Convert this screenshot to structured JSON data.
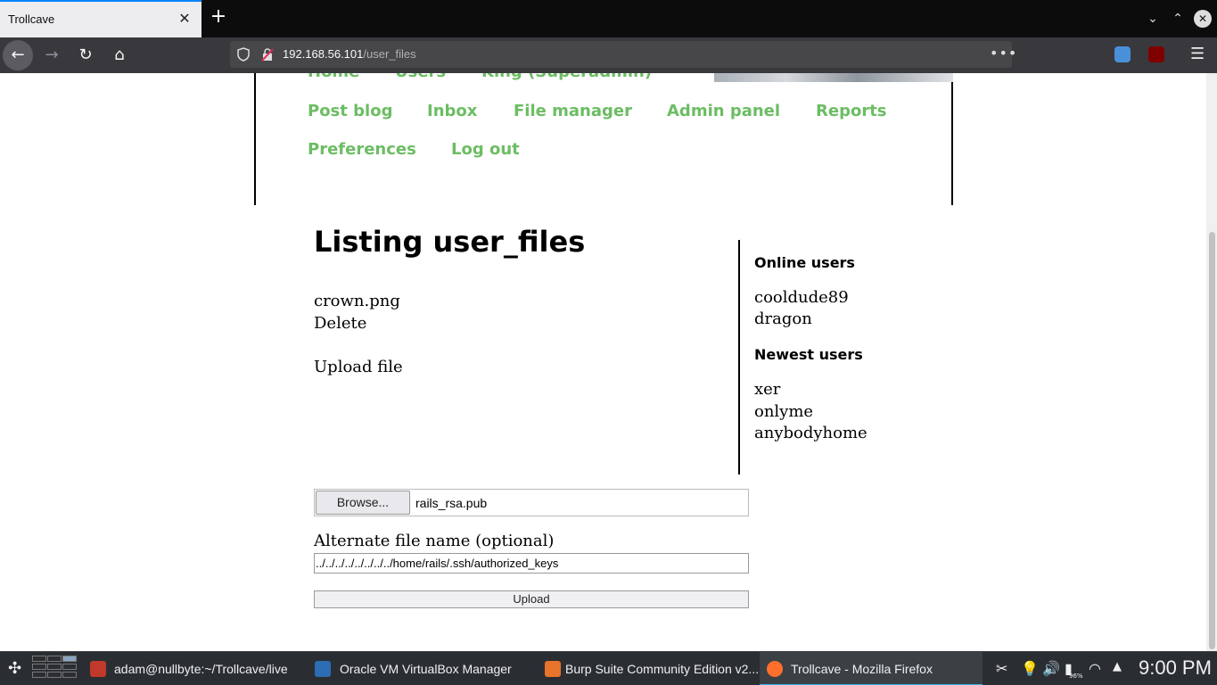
{
  "browser": {
    "tab_title": "Trollcave",
    "url_host": "192.168.56.101",
    "url_path": "/user_files"
  },
  "nav": {
    "top_row": [
      "Home",
      "Users",
      "King (Superadmin)"
    ],
    "row1": [
      "Post blog",
      "Inbox",
      "File manager",
      "Admin panel",
      "Reports"
    ],
    "row2": [
      "Preferences",
      "Log out"
    ]
  },
  "main": {
    "title": "Listing user_files",
    "file_name": "crown.png",
    "delete_label": "Delete",
    "upload_link": "Upload file"
  },
  "sidebar": {
    "online_heading": "Online users",
    "online_users": [
      "cooldude89",
      "dragon"
    ],
    "newest_heading": "Newest users",
    "newest_users": [
      "xer",
      "onlyme",
      "anybodyhome"
    ]
  },
  "form": {
    "browse_label": "Browse...",
    "selected_file": "rails_rsa.pub",
    "alt_name_label": "Alternate file name (optional)",
    "alt_name_value": "../../../../../../../../home/rails/.ssh/authorized_keys",
    "upload_label": "Upload"
  },
  "taskbar": {
    "tasks": [
      "adam@nullbyte:~/Trollcave/live",
      "Oracle VM VirtualBox Manager",
      "Burp Suite Community Edition v2...",
      "Trollcave - Mozilla Firefox"
    ],
    "battery": "96%",
    "clock": "9:00 PM"
  },
  "colors": {
    "nav_link": "#6cbd63",
    "focus_accent": "#0a84ff"
  }
}
